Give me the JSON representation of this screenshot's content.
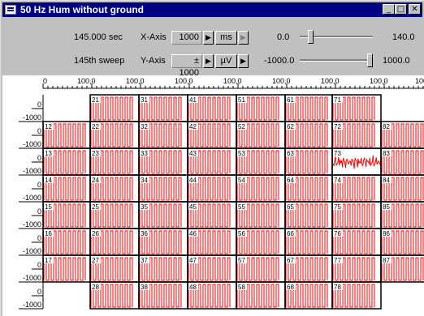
{
  "window": {
    "title": "50 Hz Hum without ground"
  },
  "titlebar_buttons": {
    "minimize": "_",
    "maximize": "□",
    "close": "✕"
  },
  "toolbar": {
    "time": "145.000 sec",
    "sweep": "145th sweep",
    "x_axis_label": "X-Axis",
    "x_axis_value": "1000",
    "x_axis_unit": "ms",
    "y_axis_label": "Y-Axis",
    "y_axis_value": "± 1000",
    "y_axis_unit": "µV",
    "x_min": "0.0",
    "x_max": "140.0",
    "y_min": "-1000.0",
    "y_max": "1000.0"
  },
  "sliders": {
    "x_position": 0.12,
    "y_position": 1.0
  },
  "colors": {
    "trace": "#ff0000",
    "title_bar": "#000080",
    "face": "#c0c0c0"
  },
  "grid": {
    "x_labels": [
      "0",
      "100,0",
      "100,0",
      "100,0",
      "100,0",
      "100,0",
      "100,0",
      "100,0",
      "100"
    ],
    "row_labels": [
      "0",
      "-1000",
      "0",
      "-1000",
      "0",
      "-1000",
      "0",
      "-1000",
      "0",
      "-1000",
      "0",
      "-1000",
      "0",
      "-1000",
      "0",
      "-1000"
    ],
    "cells": [
      [
        "",
        "21",
        "31",
        "41",
        "51",
        "61",
        "71",
        ""
      ],
      [
        "12",
        "22",
        "32",
        "42",
        "52",
        "62",
        "72",
        "82"
      ],
      [
        "13",
        "23",
        "33",
        "43",
        "53",
        "63",
        "73",
        "83"
      ],
      [
        "14",
        "24",
        "34",
        "44",
        "54",
        "64",
        "74",
        "84"
      ],
      [
        "15",
        "25",
        "35",
        "45",
        "55",
        "65",
        "75",
        "85"
      ],
      [
        "16",
        "26",
        "36",
        "46",
        "56",
        "66",
        "76",
        "86"
      ],
      [
        "17",
        "27",
        "37",
        "47",
        "57",
        "67",
        "77",
        "87"
      ],
      [
        "",
        "28",
        "38",
        "48",
        "58",
        "68",
        "78",
        ""
      ]
    ],
    "noisy_channel": "73"
  }
}
